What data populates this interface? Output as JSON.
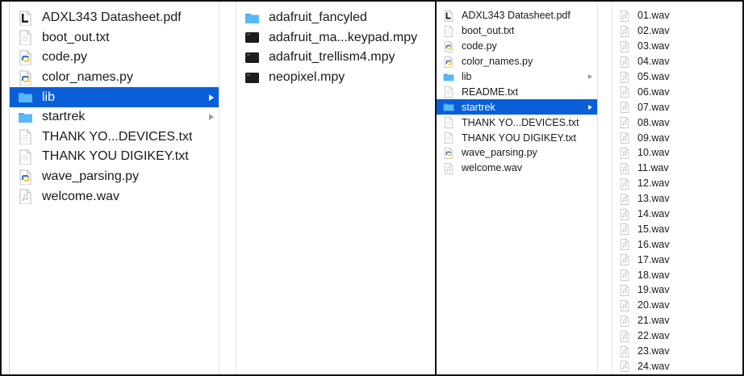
{
  "colors": {
    "selection": "#0a5fd8",
    "folder": "#5ab8f5",
    "python_blue": "#3d77b4",
    "python_yellow": "#f5c93b",
    "binary_file": "#1d1d1d"
  },
  "left_window": {
    "column1": [
      {
        "name": "ADXL343 Datasheet.pdf",
        "icon": "pdf-icon",
        "chevron": false,
        "selected": false
      },
      {
        "name": "boot_out.txt",
        "icon": "text-file-icon",
        "chevron": false,
        "selected": false
      },
      {
        "name": "code.py",
        "icon": "python-file-icon",
        "chevron": false,
        "selected": false
      },
      {
        "name": "color_names.py",
        "icon": "python-file-icon",
        "chevron": false,
        "selected": false
      },
      {
        "name": "lib",
        "icon": "folder-icon",
        "chevron": true,
        "selected": true
      },
      {
        "name": "startrek",
        "icon": "folder-icon",
        "chevron": true,
        "selected": false
      },
      {
        "name": "THANK YO...DEVICES.txt",
        "icon": "text-file-icon",
        "chevron": false,
        "selected": false
      },
      {
        "name": "THANK YOU DIGIKEY.txt",
        "icon": "text-file-icon",
        "chevron": false,
        "selected": false
      },
      {
        "name": "wave_parsing.py",
        "icon": "python-file-icon",
        "chevron": false,
        "selected": false
      },
      {
        "name": "welcome.wav",
        "icon": "audio-file-icon",
        "chevron": false,
        "selected": false
      }
    ],
    "column2": [
      {
        "name": "adafruit_fancyled",
        "icon": "folder-icon",
        "chevron": false,
        "selected": false
      },
      {
        "name": "adafruit_ma...keypad.mpy",
        "icon": "binary-file-icon",
        "chevron": false,
        "selected": false
      },
      {
        "name": "adafruit_trellism4.mpy",
        "icon": "binary-file-icon",
        "chevron": false,
        "selected": false
      },
      {
        "name": "neopixel.mpy",
        "icon": "binary-file-icon",
        "chevron": false,
        "selected": false
      }
    ]
  },
  "right_window": {
    "column1": [
      {
        "name": "ADXL343 Datasheet.pdf",
        "icon": "pdf-icon",
        "chevron": false,
        "selected": false
      },
      {
        "name": "boot_out.txt",
        "icon": "text-file-icon",
        "chevron": false,
        "selected": false
      },
      {
        "name": "code.py",
        "icon": "python-file-icon",
        "chevron": false,
        "selected": false
      },
      {
        "name": "color_names.py",
        "icon": "python-file-icon",
        "chevron": false,
        "selected": false
      },
      {
        "name": "lib",
        "icon": "folder-icon",
        "chevron": true,
        "selected": false
      },
      {
        "name": "README.txt",
        "icon": "text-file-icon",
        "chevron": false,
        "selected": false
      },
      {
        "name": "startrek",
        "icon": "folder-icon",
        "chevron": true,
        "selected": true
      },
      {
        "name": "THANK YO...DEVICES.txt",
        "icon": "text-file-icon",
        "chevron": false,
        "selected": false
      },
      {
        "name": "THANK YOU DIGIKEY.txt",
        "icon": "text-file-icon",
        "chevron": false,
        "selected": false
      },
      {
        "name": "wave_parsing.py",
        "icon": "python-file-icon",
        "chevron": false,
        "selected": false
      },
      {
        "name": "welcome.wav",
        "icon": "audio-file-icon",
        "chevron": false,
        "selected": false
      }
    ],
    "column2": [
      {
        "name": "01.wav",
        "icon": "audio-file-icon"
      },
      {
        "name": "02.wav",
        "icon": "audio-file-icon"
      },
      {
        "name": "03.wav",
        "icon": "audio-file-icon"
      },
      {
        "name": "04.wav",
        "icon": "audio-file-icon"
      },
      {
        "name": "05.wav",
        "icon": "audio-file-icon"
      },
      {
        "name": "06.wav",
        "icon": "audio-file-icon"
      },
      {
        "name": "07.wav",
        "icon": "audio-file-icon"
      },
      {
        "name": "08.wav",
        "icon": "audio-file-icon"
      },
      {
        "name": "09.wav",
        "icon": "audio-file-icon"
      },
      {
        "name": "10.wav",
        "icon": "audio-file-icon"
      },
      {
        "name": "11.wav",
        "icon": "audio-file-icon"
      },
      {
        "name": "12.wav",
        "icon": "audio-file-icon"
      },
      {
        "name": "13.wav",
        "icon": "audio-file-icon"
      },
      {
        "name": "14.wav",
        "icon": "audio-file-icon"
      },
      {
        "name": "15.wav",
        "icon": "audio-file-icon"
      },
      {
        "name": "16.wav",
        "icon": "audio-file-icon"
      },
      {
        "name": "17.wav",
        "icon": "audio-file-icon"
      },
      {
        "name": "18.wav",
        "icon": "audio-file-icon"
      },
      {
        "name": "19.wav",
        "icon": "audio-file-icon"
      },
      {
        "name": "20.wav",
        "icon": "audio-file-icon"
      },
      {
        "name": "21.wav",
        "icon": "audio-file-icon"
      },
      {
        "name": "22.wav",
        "icon": "audio-file-icon"
      },
      {
        "name": "23.wav",
        "icon": "audio-file-icon"
      },
      {
        "name": "24.wav",
        "icon": "audio-file-icon"
      }
    ]
  }
}
